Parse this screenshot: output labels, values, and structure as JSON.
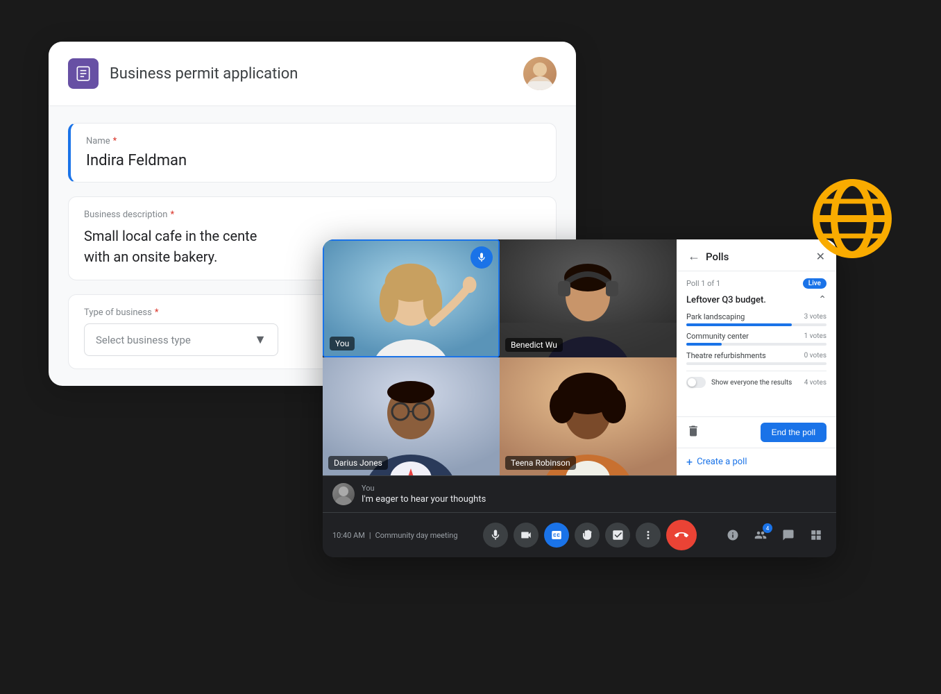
{
  "form": {
    "title": "Business permit application",
    "icon_label": "form-icon",
    "fields": {
      "name": {
        "label": "Name",
        "required": true,
        "value": "Indira Feldman"
      },
      "business_description": {
        "label": "Business description",
        "required": true,
        "value": "Small local cafe in the cente\nwith an onsite bakery."
      },
      "type_of_business": {
        "label": "Type of business",
        "required": true,
        "placeholder": "Select business type"
      }
    }
  },
  "video_call": {
    "participants": [
      {
        "name": "You",
        "is_self": true
      },
      {
        "name": "Benedict Wu",
        "is_self": false
      },
      {
        "name": "Darius Jones",
        "is_self": false
      },
      {
        "name": "Teena Robinson",
        "is_self": false
      }
    ],
    "time": "10:40 AM",
    "meeting_name": "Community day meeting",
    "chat": {
      "sender": "You",
      "message": "I'm eager to hear your thoughts"
    },
    "controls": {
      "mic_label": "microphone",
      "camera_label": "camera",
      "captions_label": "captions",
      "raise_hand_label": "raise hand",
      "activities_label": "activities",
      "more_label": "more options",
      "end_call_label": "end call",
      "info_label": "info",
      "participants_count": "4",
      "chat_label": "chat",
      "grid_label": "grid view"
    }
  },
  "polls": {
    "title": "Polls",
    "back_label": "back",
    "close_label": "close",
    "poll_page": "Poll 1 of 1",
    "live_label": "Live",
    "question": "Leftover Q3 budget.",
    "options": [
      {
        "label": "Park landscaping",
        "votes": 3,
        "percent": 75
      },
      {
        "label": "Community center",
        "votes": 1,
        "percent": 25
      },
      {
        "label": "Theatre refurbishments",
        "votes": 0,
        "percent": 0
      }
    ],
    "show_results_label": "Show everyone the results",
    "show_results_votes": "4 votes",
    "end_poll_label": "End the poll",
    "create_poll_label": "Create a poll"
  },
  "globe": {
    "color": "#F9AB00"
  }
}
